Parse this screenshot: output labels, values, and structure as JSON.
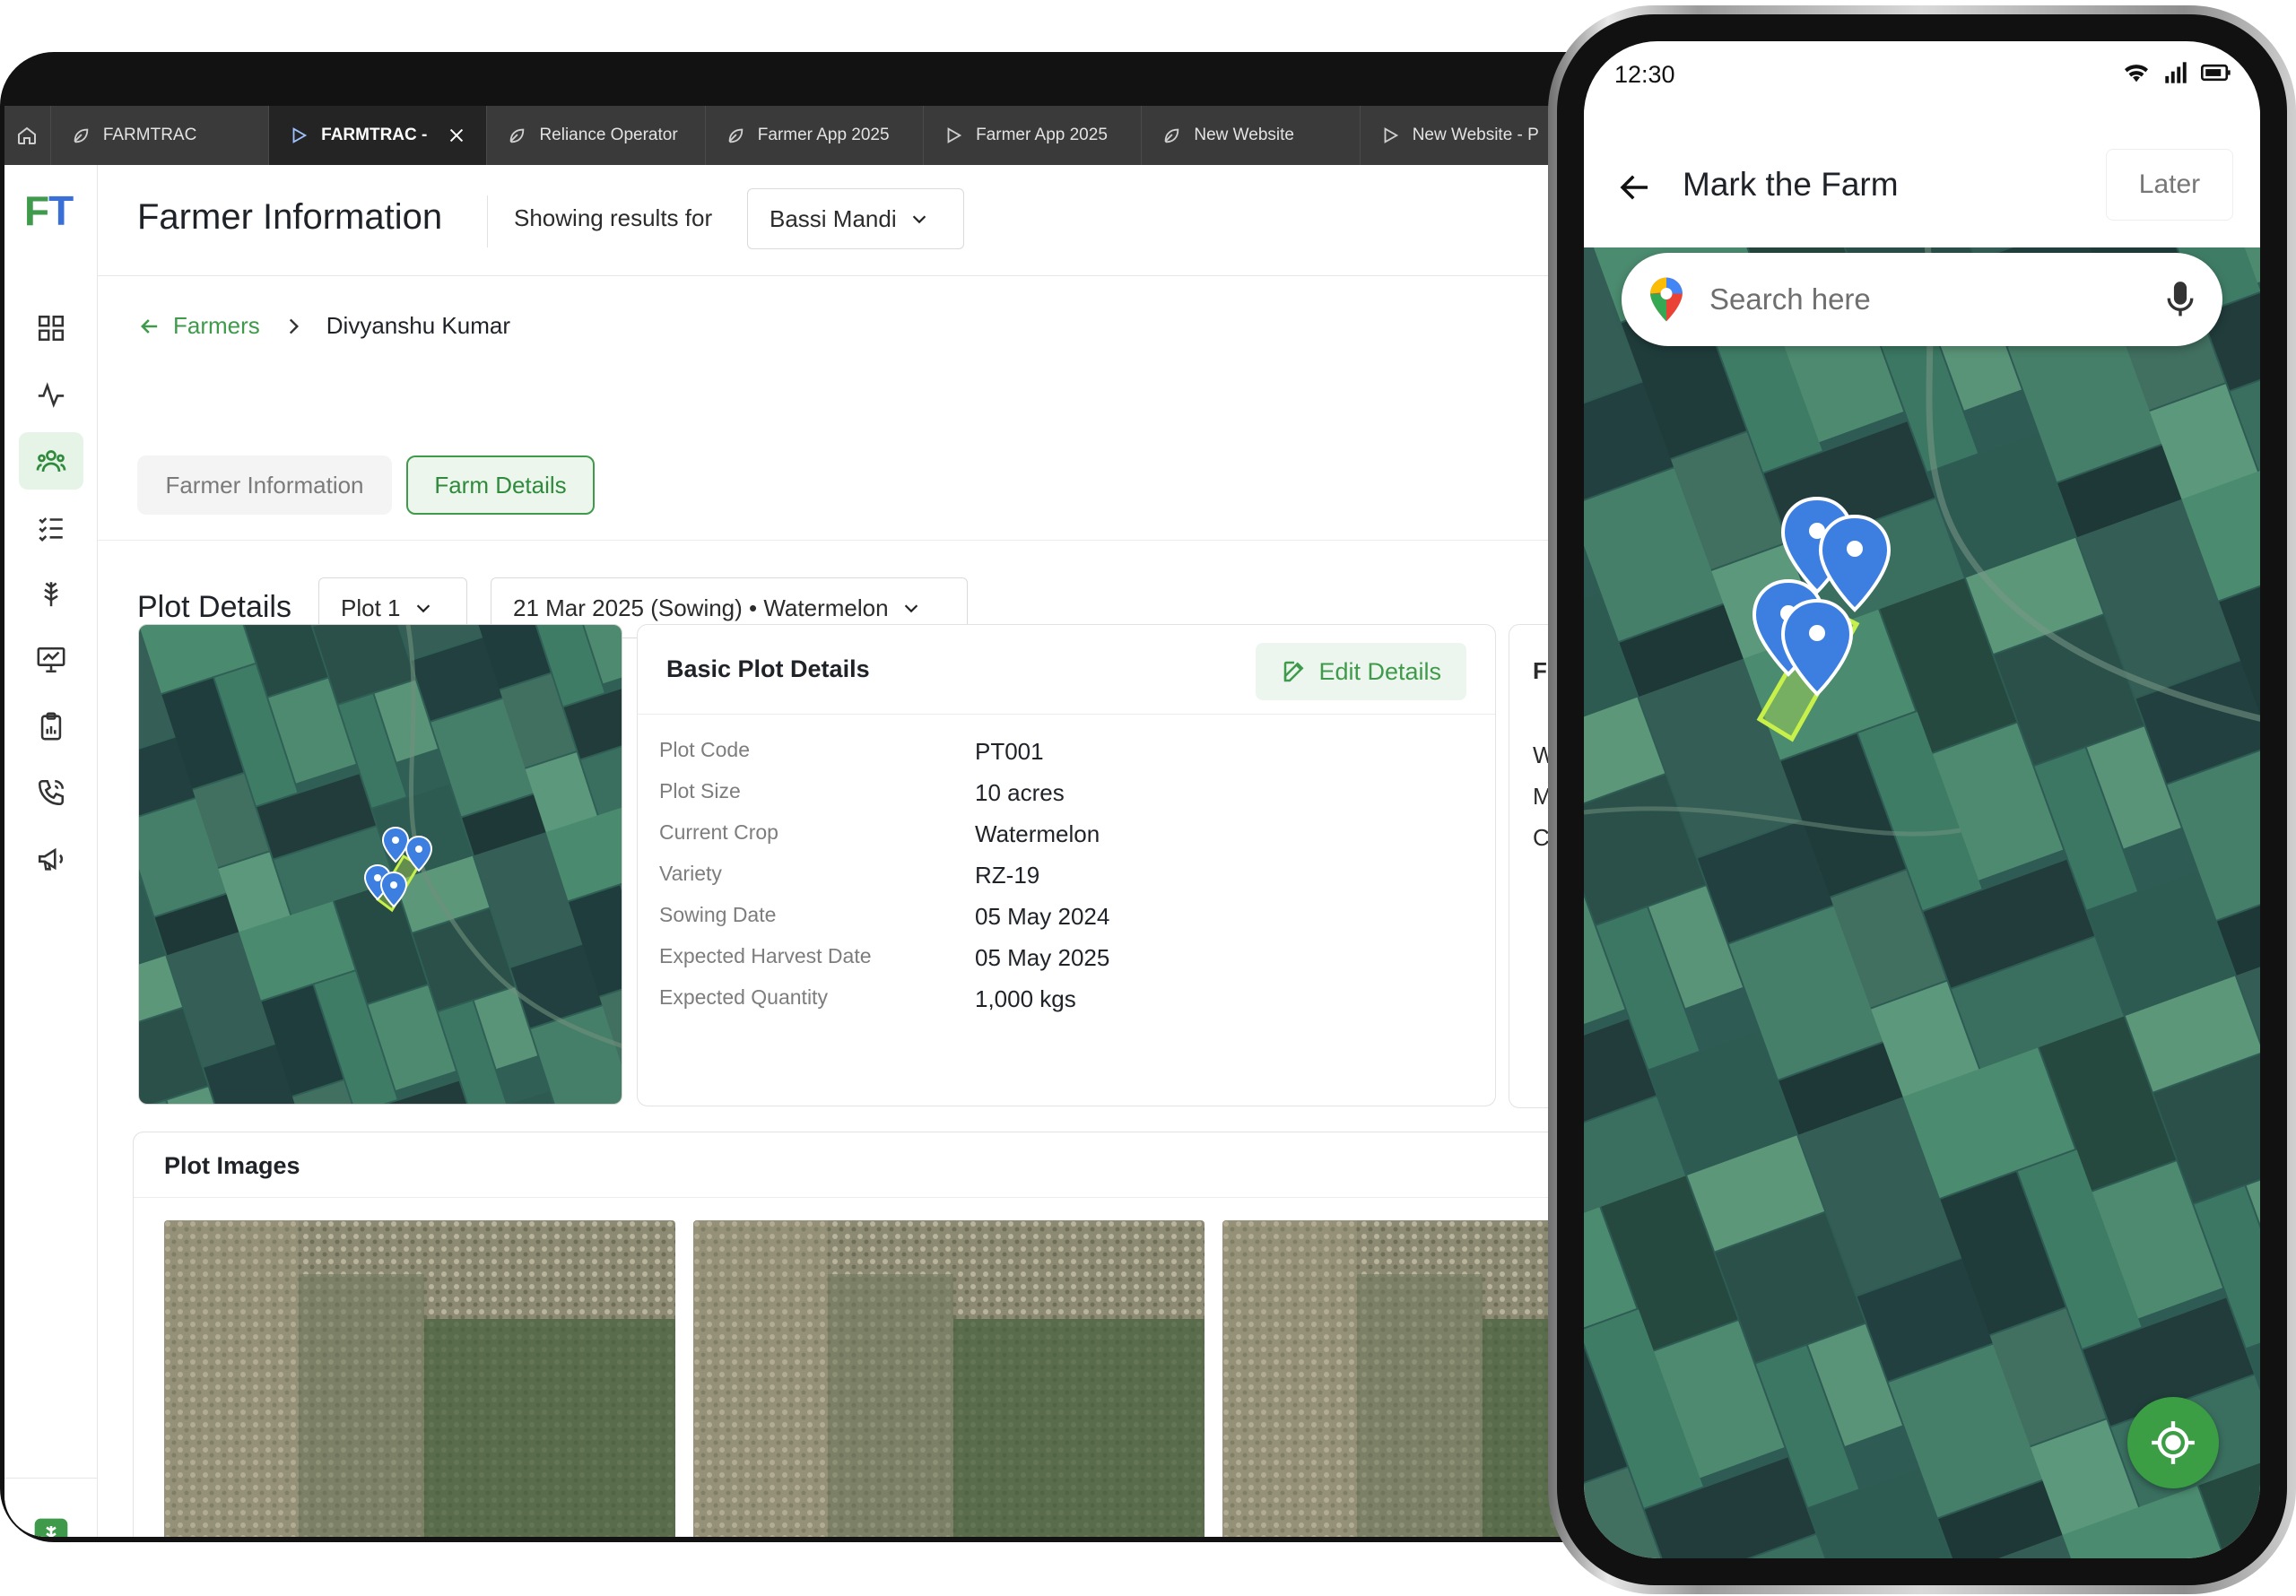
{
  "browser_tabs": [
    {
      "label": "FARMTRAC",
      "icon": "leaf-icon",
      "active": false
    },
    {
      "label": "FARMTRAC -",
      "icon": "play-icon",
      "active": true
    },
    {
      "label": "Reliance Operator",
      "icon": "leaf-icon",
      "active": false
    },
    {
      "label": "Farmer App 2025",
      "icon": "leaf-icon",
      "active": false
    },
    {
      "label": "Farmer App 2025",
      "icon": "play-icon",
      "active": false
    },
    {
      "label": "New Website",
      "icon": "leaf-icon",
      "active": false
    },
    {
      "label": "New Website - P",
      "icon": "play-icon",
      "active": false
    }
  ],
  "sidebar": {
    "logo_f": "F",
    "logo_t": "T",
    "items": [
      "grid-icon",
      "activity-icon",
      "users-icon",
      "checklist-icon",
      "crop-icon",
      "presentation-icon",
      "clipboard-icon",
      "phone-icon",
      "megaphone-icon"
    ],
    "active_item": "users-icon",
    "bottom": [
      "app-badge-icon",
      "tools-icon"
    ]
  },
  "header": {
    "title": "Farmer Information",
    "showing_label": "Showing results for",
    "location_selected": "Bassi Mandi"
  },
  "breadcrumb": {
    "parent": "Farmers",
    "current": "Divyanshu Kumar"
  },
  "farmer_tabs": [
    {
      "label": "Farmer Information",
      "active": false
    },
    {
      "label": "Farm Details",
      "active": true
    }
  ],
  "plot": {
    "section_title": "Plot Details",
    "plot_selected": "Plot 1",
    "season_selected": "21 Mar 2025 (Sowing) • Watermelon"
  },
  "basic_details": {
    "title": "Basic Plot Details",
    "edit_label": "Edit Details",
    "rows": [
      {
        "label": "Plot Code",
        "value": "PT001"
      },
      {
        "label": "Plot Size",
        "value": "10 acres"
      },
      {
        "label": "Current Crop",
        "value": "Watermelon"
      },
      {
        "label": "Variety",
        "value": "RZ-19"
      },
      {
        "label": "Sowing Date",
        "value": "05 May 2024"
      },
      {
        "label": "Expected Harvest Date",
        "value": "05 May 2025"
      },
      {
        "label": "Expected Quantity",
        "value": "1,000 kgs"
      }
    ]
  },
  "clipped_card": {
    "title": "F",
    "rows": [
      "W",
      "M",
      "C"
    ]
  },
  "plot_images": {
    "title": "Plot Images"
  },
  "phone": {
    "time": "12:30",
    "title": "Mark the Farm",
    "later_label": "Later",
    "search_placeholder": "Search here"
  },
  "colors": {
    "brand_green": "#3f9a4b",
    "brand_blue": "#3a6fd8",
    "pin_blue": "#3d7fe0",
    "polygon": "#c8f04a"
  }
}
